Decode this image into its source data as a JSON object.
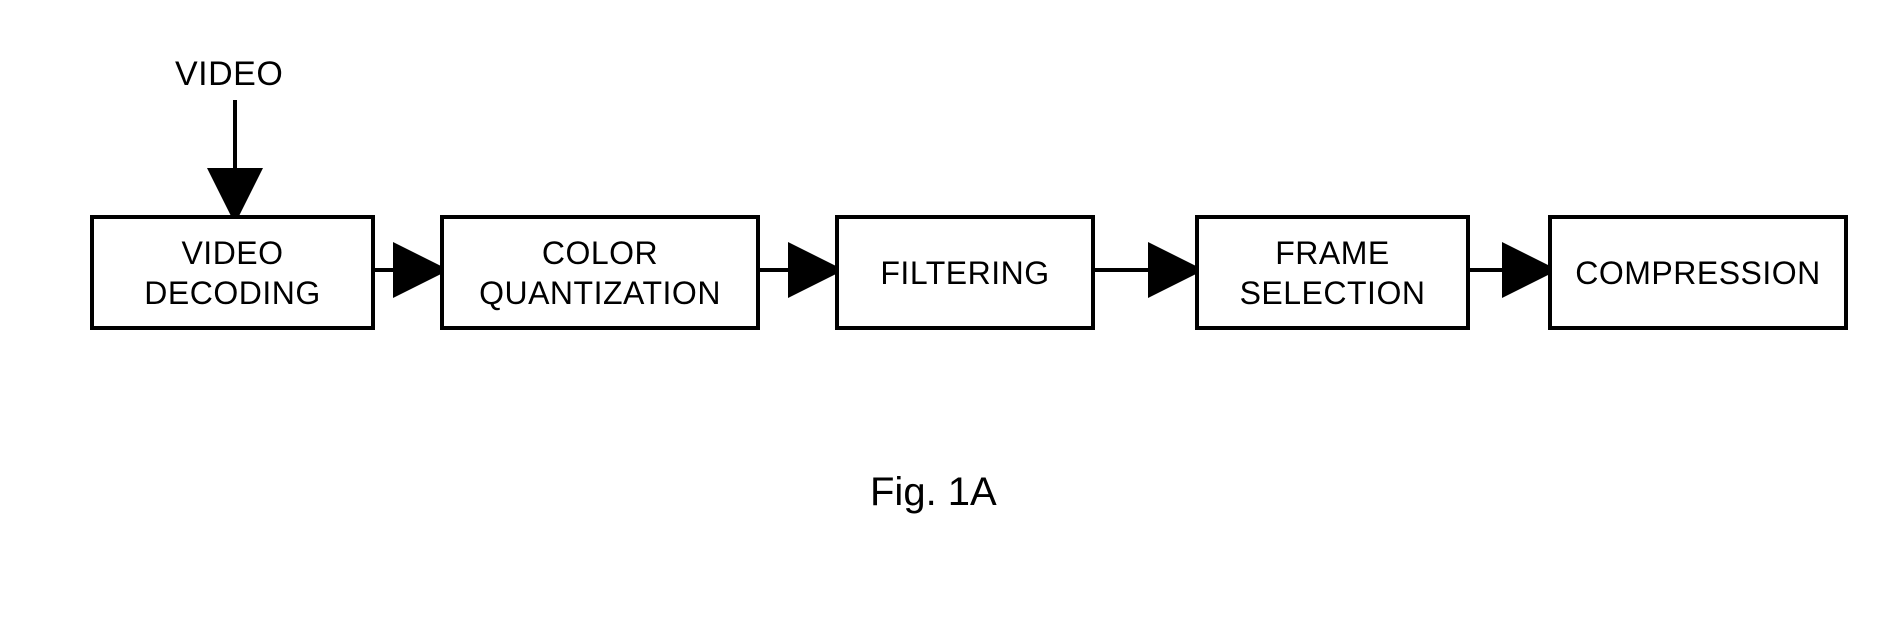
{
  "input_label": "VIDEO",
  "blocks": {
    "video_decoding": "VIDEO\nDECODING",
    "color_quantization": "COLOR\nQUANTIZATION",
    "filtering": "FILTERING",
    "frame_selection": "FRAME\nSELECTION",
    "compression": "COMPRESSION"
  },
  "caption": "Fig. 1A"
}
